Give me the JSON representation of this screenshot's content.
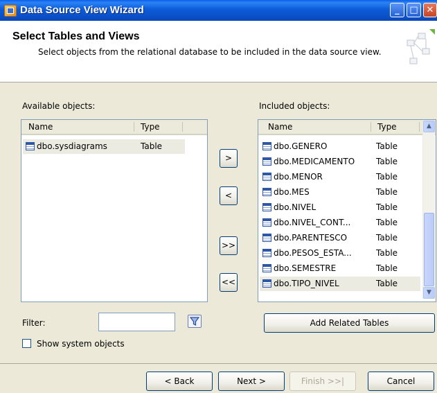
{
  "window": {
    "title": "Data Source View Wizard",
    "minimize_glyph": "_",
    "maximize_glyph": "□",
    "close_glyph": "✕"
  },
  "header": {
    "title": "Select Tables and Views",
    "subtitle": "Select objects from the relational database to be included in the data source view."
  },
  "available": {
    "label": "Available objects:",
    "columns": [
      "Name",
      "Type"
    ],
    "rows": [
      {
        "name": "dbo.sysdiagrams",
        "type": "Table",
        "selected": true
      }
    ]
  },
  "included": {
    "label": "Included objects:",
    "columns": [
      "Name",
      "Type"
    ],
    "rows": [
      {
        "name": "dbo.GENERO",
        "type": "Table"
      },
      {
        "name": "dbo.MEDICAMENTO",
        "type": "Table"
      },
      {
        "name": "dbo.MENOR",
        "type": "Table"
      },
      {
        "name": "dbo.MES",
        "type": "Table"
      },
      {
        "name": "dbo.NIVEL",
        "type": "Table"
      },
      {
        "name": "dbo.NIVEL_CONT...",
        "type": "Table"
      },
      {
        "name": "dbo.PARENTESCO",
        "type": "Table"
      },
      {
        "name": "dbo.PESOS_ESTA...",
        "type": "Table"
      },
      {
        "name": "dbo.SEMESTRE",
        "type": "Table"
      },
      {
        "name": "dbo.TIPO_NIVEL",
        "type": "Table",
        "selected": true
      }
    ]
  },
  "transfer": {
    "add": ">",
    "remove": "<",
    "add_all": ">>",
    "remove_all": "<<"
  },
  "filter": {
    "label": "Filter:",
    "value": "",
    "icon": "funnel-icon"
  },
  "add_related_label": "Add Related Tables",
  "show_system": {
    "label": "Show system objects",
    "checked": false
  },
  "footer": {
    "back": "< Back",
    "next": "Next >",
    "finish": "Finish >>|",
    "cancel": "Cancel"
  }
}
